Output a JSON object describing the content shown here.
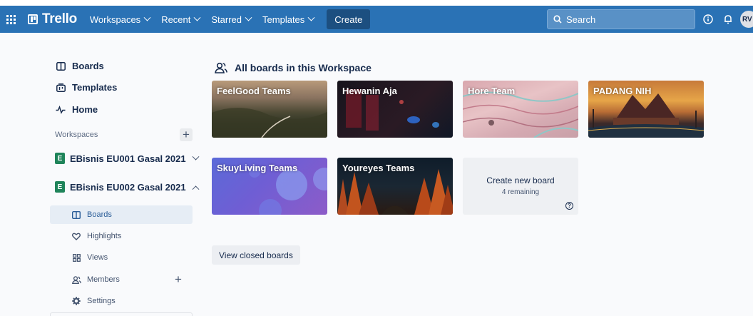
{
  "header": {
    "brand": "Trello",
    "menus": [
      {
        "label": "Workspaces"
      },
      {
        "label": "Recent"
      },
      {
        "label": "Starred"
      },
      {
        "label": "Templates"
      }
    ],
    "create_label": "Create",
    "search_placeholder": "Search",
    "avatar_initials": "RV"
  },
  "sidebar": {
    "nav": [
      {
        "label": "Boards",
        "icon": "board-icon"
      },
      {
        "label": "Templates",
        "icon": "template-icon"
      },
      {
        "label": "Home",
        "icon": "pulse-icon"
      }
    ],
    "workspaces_title": "Workspaces",
    "workspaces": [
      {
        "badge": "E",
        "name": "EBisnis EU001 Gasal 2021",
        "expanded": false
      },
      {
        "badge": "E",
        "name": "EBisnis EU002 Gasal 2021",
        "expanded": true
      }
    ],
    "sub_items": [
      {
        "label": "Boards",
        "icon": "board-icon",
        "active": true
      },
      {
        "label": "Highlights",
        "icon": "heart-icon",
        "active": false
      },
      {
        "label": "Views",
        "icon": "grid-icon",
        "active": false
      },
      {
        "label": "Members",
        "icon": "members-icon",
        "active": false
      },
      {
        "label": "Settings",
        "icon": "gear-icon",
        "active": false
      }
    ]
  },
  "main": {
    "title": "All boards in this Workspace",
    "boards": [
      {
        "name": "FeelGood Teams"
      },
      {
        "name": "Hewanin Aja"
      },
      {
        "name": "Hore Team"
      },
      {
        "name": "PADANG NIH"
      },
      {
        "name": "SkuyLiving Teams"
      },
      {
        "name": "Youreyes Teams"
      }
    ],
    "create_board": {
      "label": "Create new board",
      "remaining": "4 remaining"
    },
    "view_closed_label": "View closed boards"
  },
  "colors": {
    "header": "#2a72b5",
    "create_button": "#1c4f80",
    "workspace_badge": "#1f845a",
    "active_item_bg": "#e6edf5"
  }
}
